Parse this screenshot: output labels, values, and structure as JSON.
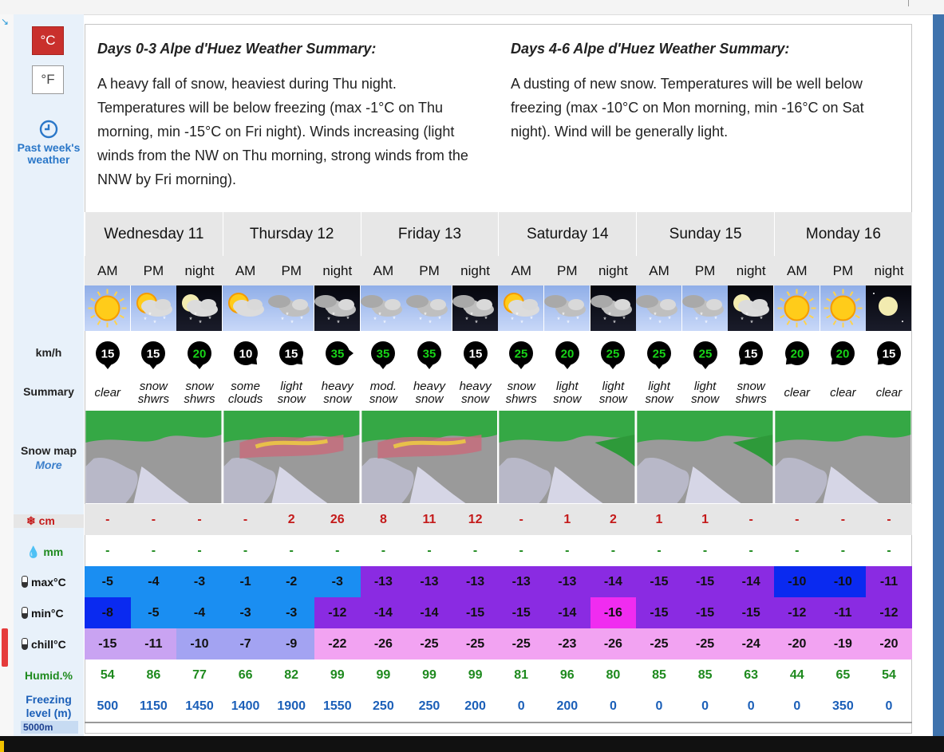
{
  "units": {
    "celsius": "°C",
    "fahrenheit": "°F"
  },
  "past_weather": "Past week's weather",
  "summary": {
    "left": {
      "title": "Days 0-3 Alpe d'Huez Weather Summary:",
      "text": "A heavy fall of snow, heaviest during Thu night. Temperatures will be below freezing (max -1°C on Thu morning, min -15°C on Fri night). Winds increasing (light winds from the NW on Thu morning, strong winds from the NNW by Fri morning)."
    },
    "right": {
      "title": "Days 4-6 Alpe d'Huez Weather Summary:",
      "text": "A dusting of new snow. Temperatures will be well below freezing (max -10°C on Mon morning, min -16°C on Sat night). Wind will be generally light."
    }
  },
  "row_labels": {
    "wind": "km/h",
    "summary": "Summary",
    "snow_map": "Snow map",
    "snow_map_more": "More",
    "snow": "cm",
    "rain": "mm",
    "max": "max°C",
    "min": "min°C",
    "chill": "chill°C",
    "humid": "Humid.%",
    "freeze": "Freezing level (m)",
    "freeze_alt": "5000m"
  },
  "days": [
    "Wednesday 11",
    "Thursday 12",
    "Friday 13",
    "Saturday 14",
    "Sunday 15",
    "Monday 16"
  ],
  "periods": [
    "AM",
    "PM",
    "night"
  ],
  "icons": [
    "sun",
    "sun-cloud-snow",
    "moon-cloud-snow",
    "sun-cloud",
    "cloud-snow",
    "cloud-snow-night",
    "cloud-snow",
    "cloud-snow",
    "cloud-snow-night",
    "sun-cloud-snow",
    "cloud-snow",
    "cloud-snow-night",
    "cloud-snow",
    "cloud-snow",
    "moon-cloud-snow",
    "sun",
    "sun",
    "moon"
  ],
  "wind": [
    "15",
    "15",
    "20",
    "10",
    "15",
    "35",
    "35",
    "35",
    "15",
    "25",
    "20",
    "25",
    "25",
    "25",
    "15",
    "20",
    "20",
    "15"
  ],
  "wind_dir": [
    180,
    180,
    180,
    135,
    135,
    90,
    180,
    180,
    180,
    180,
    180,
    180,
    180,
    180,
    225,
    225,
    225,
    225
  ],
  "wind_color": [
    "#ffffff",
    "#ffffff",
    "#18d418",
    "#ffffff",
    "#ffffff",
    "#18d418",
    "#18d418",
    "#18d418",
    "#ffffff",
    "#18d418",
    "#18d418",
    "#18d418",
    "#18d418",
    "#18d418",
    "#ffffff",
    "#18d418",
    "#18d418",
    "#ffffff"
  ],
  "summaries": [
    "clear",
    "snow shwrs",
    "snow shwrs",
    "some clouds",
    "light snow",
    "heavy snow",
    "mod. snow",
    "heavy snow",
    "heavy snow",
    "snow shwrs",
    "light snow",
    "light snow",
    "light snow",
    "light snow",
    "snow shwrs",
    "clear",
    "clear",
    "clear"
  ],
  "snow_cm": [
    "-",
    "-",
    "-",
    "-",
    "2",
    "26",
    "8",
    "11",
    "12",
    "-",
    "1",
    "2",
    "1",
    "1",
    "-",
    "-",
    "-",
    "-"
  ],
  "rain_mm": [
    "-",
    "-",
    "-",
    "-",
    "-",
    "-",
    "-",
    "-",
    "-",
    "-",
    "-",
    "-",
    "-",
    "-",
    "-",
    "-",
    "-",
    "-"
  ],
  "max_c": [
    "-5",
    "-4",
    "-3",
    "-1",
    "-2",
    "-3",
    "-13",
    "-13",
    "-13",
    "-13",
    "-13",
    "-14",
    "-15",
    "-15",
    "-14",
    "-10",
    "-10",
    "-11"
  ],
  "max_bg": [
    "#1a8ef2",
    "#1a8ef2",
    "#1a8ef2",
    "#1a8ef2",
    "#1a8ef2",
    "#1a8ef2",
    "#8a2be2",
    "#8a2be2",
    "#8a2be2",
    "#8a2be2",
    "#8a2be2",
    "#8a2be2",
    "#8a2be2",
    "#8a2be2",
    "#8a2be2",
    "#0a2af0",
    "#0a2af0",
    "#8a2be2"
  ],
  "min_c": [
    "-8",
    "-5",
    "-4",
    "-3",
    "-3",
    "-12",
    "-14",
    "-14",
    "-15",
    "-15",
    "-14",
    "-16",
    "-15",
    "-15",
    "-15",
    "-12",
    "-11",
    "-12"
  ],
  "min_bg": [
    "#0a2af0",
    "#1a8ef2",
    "#1a8ef2",
    "#1a8ef2",
    "#1a8ef2",
    "#8a2be2",
    "#8a2be2",
    "#8a2be2",
    "#8a2be2",
    "#8a2be2",
    "#8a2be2",
    "#f02cf0",
    "#8a2be2",
    "#8a2be2",
    "#8a2be2",
    "#8a2be2",
    "#8a2be2",
    "#8a2be2"
  ],
  "chill_c": [
    "-15",
    "-11",
    "-10",
    "-7",
    "-9",
    "-22",
    "-26",
    "-25",
    "-25",
    "-25",
    "-23",
    "-26",
    "-25",
    "-25",
    "-24",
    "-20",
    "-19",
    "-20"
  ],
  "chill_bg": [
    "#c9a3f2",
    "#c9a3f2",
    "#a3a3f2",
    "#a3a3f2",
    "#a3a3f2",
    "#f2a3f2",
    "#f2a3f2",
    "#f2a3f2",
    "#f2a3f2",
    "#f2a3f2",
    "#f2a3f2",
    "#f2a3f2",
    "#f2a3f2",
    "#f2a3f2",
    "#f2a3f2",
    "#f2a3f2",
    "#f2a3f2",
    "#f2a3f2"
  ],
  "humid": [
    "54",
    "86",
    "77",
    "66",
    "82",
    "99",
    "99",
    "99",
    "99",
    "81",
    "96",
    "80",
    "85",
    "85",
    "63",
    "44",
    "65",
    "54"
  ],
  "freeze_m": [
    "500",
    "1150",
    "1450",
    "1400",
    "1900",
    "1550",
    "250",
    "250",
    "200",
    "0",
    "200",
    "0",
    "0",
    "0",
    "0",
    "0",
    "350",
    "0"
  ],
  "colors": {
    "celsius_active": "#c9302c",
    "link": "#2a77c8",
    "snow": "#c41a1a",
    "rain": "#1e8a1e",
    "freeze": "#1b5fb8"
  }
}
